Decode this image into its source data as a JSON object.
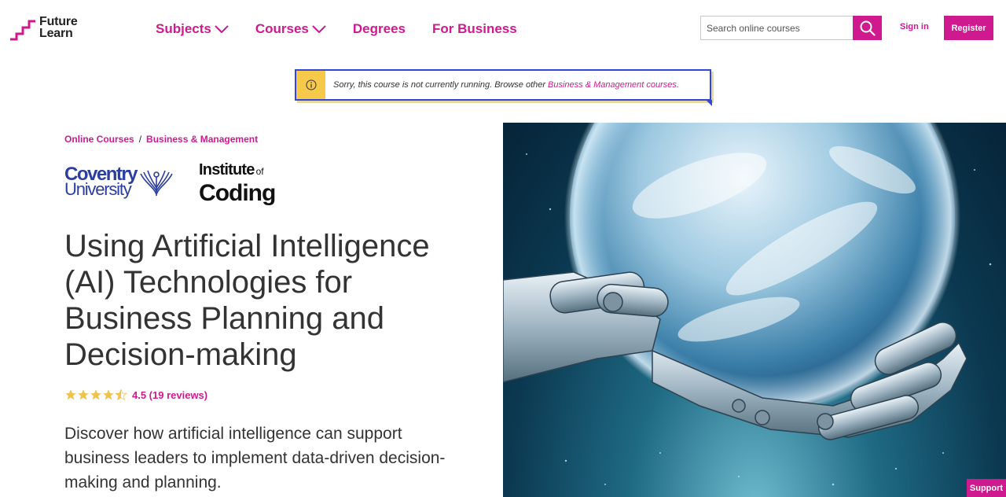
{
  "header": {
    "logo_line1": "Future",
    "logo_line2": "Learn",
    "nav": [
      {
        "label": "Subjects",
        "has_dropdown": true
      },
      {
        "label": "Courses",
        "has_dropdown": true
      },
      {
        "label": "Degrees",
        "has_dropdown": false
      },
      {
        "label": "For Business",
        "has_dropdown": false
      }
    ],
    "search_placeholder": "Search online courses",
    "signin_label": "Sign in",
    "register_label": "Register"
  },
  "notice": {
    "text": "Sorry, this course is not currently running. Browse other",
    "link": "Business & Management courses."
  },
  "breadcrumb": {
    "items": [
      "Online Courses",
      "Business & Management"
    ],
    "separator": "/"
  },
  "partners": {
    "coventry_line1": "Coventry",
    "coventry_line2": "University",
    "ioc_line1": "Institute",
    "ioc_of": "of",
    "ioc_line2": "Coding"
  },
  "course": {
    "title": "Using Artificial Intelligence (AI) Technologies for Business Planning and Decision-making",
    "rating": 4.5,
    "rating_text": "4.5 (19 reviews)",
    "description": "Discover how artificial intelligence can support business leaders to implement data-driven decision-making and planning."
  },
  "support_label": "Support",
  "colors": {
    "brand": "#cf1a8f",
    "notice_border": "#3347d4",
    "notice_icon_bg": "#f6c94a",
    "star": "#f2c14e",
    "coventry": "#2c3e9e"
  }
}
